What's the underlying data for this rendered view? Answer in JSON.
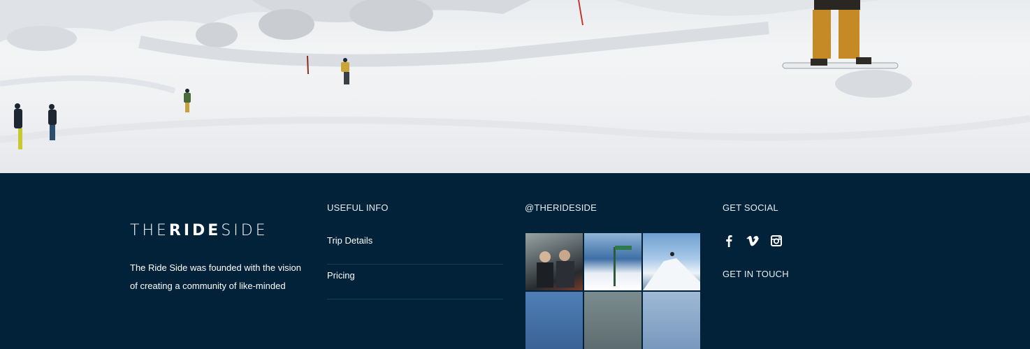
{
  "brand": {
    "logo_pre": "THE",
    "logo_bold": "RIDE",
    "logo_post": "SIDE",
    "about": "The Ride Side was founded with the vision of creating a community of like-minded"
  },
  "useful_info": {
    "title": "USEFUL INFO",
    "links": [
      "Trip Details",
      "Pricing"
    ]
  },
  "instagram": {
    "title": "@THERIDESIDE"
  },
  "social": {
    "title": "GET SOCIAL",
    "icons": [
      "facebook-icon",
      "vimeo-icon",
      "instagram-icon"
    ]
  },
  "contact": {
    "title": "GET IN TOUCH"
  },
  "colors": {
    "footer_bg": "#02223a",
    "divider": "#12405e",
    "text": "#ffffff"
  }
}
